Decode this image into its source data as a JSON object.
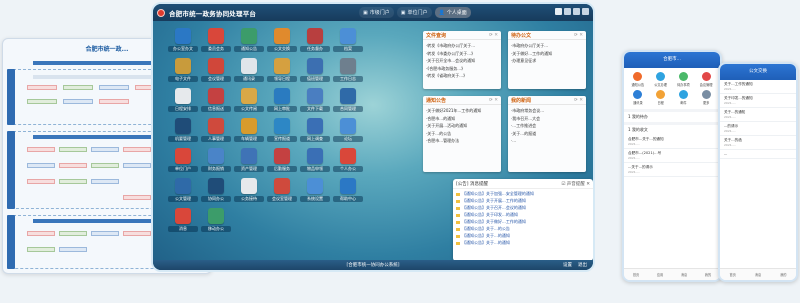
{
  "diagram": {
    "title": "合肥市统一政...",
    "bands": [
      {
        "label": "行政审批事项流程"
      },
      {
        "label": "政务服务事项流程"
      },
      {
        "label": "公共服务流程"
      }
    ]
  },
  "desktop": {
    "app_title": "合肥市统一政务协同处理平台",
    "portals": [
      "市级门户",
      "单位门户"
    ],
    "user_label": "个人桌面",
    "icons": [
      {
        "label": "办公室办文",
        "color": "#2b78c5"
      },
      {
        "label": "委员会务",
        "color": "#d9473a"
      },
      {
        "label": "通知公告",
        "color": "#3c9c6a"
      },
      {
        "label": "公文交换",
        "color": "#e08a2d"
      },
      {
        "label": "任务督办",
        "color": "#b83f3f"
      },
      {
        "label": "档案",
        "color": "#4c8fd6"
      },
      {
        "label": "电子文件",
        "color": "#c89b3c"
      },
      {
        "label": "会议管理",
        "color": "#d0473a"
      },
      {
        "label": "通讯录",
        "color": "#e0e5ea"
      },
      {
        "label": "领导日程",
        "color": "#d5a040"
      },
      {
        "label": "值班管理",
        "color": "#3c6fb1"
      },
      {
        "label": "工作日志",
        "color": "#6e7f8e"
      },
      {
        "label": "日程安排",
        "color": "#e6e9ec"
      },
      {
        "label": "信息报送",
        "color": "#c44141"
      },
      {
        "label": "公文传阅",
        "color": "#d9a847"
      },
      {
        "label": "网上审批",
        "color": "#2a7bc0"
      },
      {
        "label": "文件下载",
        "color": "#4a7ec1"
      },
      {
        "label": "合同管理",
        "color": "#2f6aa8"
      },
      {
        "label": "机要管理",
        "color": "#1f4c78"
      },
      {
        "label": "人事管理",
        "color": "#cf4a3d"
      },
      {
        "label": "车辆管理",
        "color": "#d89b2d"
      },
      {
        "label": "宣传报道",
        "color": "#2d87c5"
      },
      {
        "label": "网上调查",
        "color": "#3a6fb5"
      },
      {
        "label": "论坛",
        "color": "#4c8fd6"
      },
      {
        "label": "单位门户",
        "color": "#d9473a"
      },
      {
        "label": "财务报销",
        "color": "#4a84c8"
      },
      {
        "label": "资产管理",
        "color": "#3f73b6"
      },
      {
        "label": "后勤服务",
        "color": "#c44141"
      },
      {
        "label": "物品申领",
        "color": "#3a6fb5"
      },
      {
        "label": "个人办公",
        "color": "#d9473a"
      },
      {
        "label": "公文管理",
        "color": "#2f6aa8"
      },
      {
        "label": "协同办公",
        "color": "#1f4c78"
      },
      {
        "label": "公务接待",
        "color": "#e6e9ec"
      },
      {
        "label": "会议室管理",
        "color": "#cf4a3d"
      },
      {
        "label": "系统设置",
        "color": "#4c8fd6"
      },
      {
        "label": "帮助中心",
        "color": "#2b78c5"
      },
      {
        "label": "消息",
        "color": "#d9473a"
      },
      {
        "label": "移动办公",
        "color": "#3c9c6a"
      }
    ],
    "widgets": {
      "doc_center": {
        "title": "文件查询",
        "items": [
          "·转发《市政府办公厅关于...",
          "·转发《市委办公厅关于...》",
          "·关于召开全市...会议的通知",
          "·《合肥市政务服务...》",
          "·转发《省政府关于...》"
        ]
      },
      "todo": {
        "title": "待办公文",
        "items": [
          "·市政府办公厅关于...",
          "·关于做好...工作的通知",
          "·办理意见征求"
        ]
      },
      "notice": {
        "title": "通知公告",
        "items": [
          "·关于做好2021年...工作的通知",
          "·合肥市...的通知",
          "·关于开展...活动的通知",
          "·关于...的公告",
          "·合肥市...管理办法"
        ]
      },
      "news": {
        "title": "我的新闻",
        "items": [
          "·市政府常务会议...",
          "·我市召开...大会",
          "·...工作推进会",
          "·关于...的报道",
          "·..."
        ]
      }
    },
    "notice_popup": {
      "title": "[公告] 消息提醒",
      "mode": "声音提醒",
      "items": [
        "【通知公告】关于加强...安全管理的通知",
        "【通知公告】关于开展...工作的通知",
        "【通知公告】关于召开...会议的通知",
        "【通知公告】关于印发...的通知",
        "【通知公告】关于做好...工作的通知",
        "【通知公告】关于...的公告",
        "【通知公告】关于...的通知",
        "【通知公告】关于...的通知"
      ]
    },
    "taskbar": {
      "center": "[合肥市统一协同办公系统]",
      "right": [
        "设置",
        "退出"
      ]
    }
  },
  "phones": [
    {
      "header": "合肥市...",
      "apps": [
        {
          "label": "通知公告",
          "color": "#f06b2b"
        },
        {
          "label": "公文办理",
          "color": "#2fa3e0"
        },
        {
          "label": "待办事项",
          "color": "#4bb96a"
        },
        {
          "label": "会议管理",
          "color": "#e24848"
        },
        {
          "label": "通讯录",
          "color": "#2d7fd6"
        },
        {
          "label": "日程",
          "color": "#f2a236"
        },
        {
          "label": "邮件",
          "color": "#2fa3e0"
        },
        {
          "label": "更多",
          "color": "#7a8ea3"
        }
      ],
      "sections": [
        {
          "title": "1 我的待办",
          "items": []
        },
        {
          "title": "1 我的收文",
          "items": [
            {
              "text": "合肥市...关于...的通知",
              "sub": "2021-..."
            },
            {
              "text": "合肥市...(2021)...号",
              "sub": "2021-..."
            },
            {
              "text": "...关于...的请示",
              "sub": "2021-..."
            }
          ]
        }
      ],
      "nav": [
        "首页",
        "应用",
        "消息",
        "我的"
      ]
    },
    {
      "header": "公文交换",
      "apps": [],
      "sections": [
        {
          "title": "",
          "items": [
            {
              "text": "关于...工作的通知",
              "sub": "2021-..."
            },
            {
              "text": "关于印发...的通知",
              "sub": "2021-..."
            },
            {
              "text": "关于...的通知",
              "sub": "2021-..."
            },
            {
              "text": "...的请示",
              "sub": "2021-..."
            },
            {
              "text": "关于...的函",
              "sub": "2021-..."
            },
            {
              "text": "...",
              "sub": ""
            }
          ]
        }
      ],
      "nav": [
        "首页",
        "消息",
        "我的"
      ]
    }
  ]
}
